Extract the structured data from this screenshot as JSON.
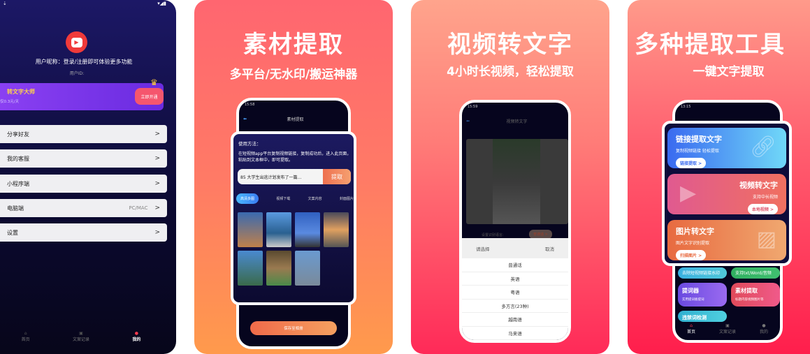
{
  "panel1": {
    "nickname": "用户昵称：登录/注册即可体验更多功能",
    "user_id_label": "用户ID:",
    "vip": {
      "title": "转文字大师",
      "price": "仅0.3元/天",
      "button": "立即开通"
    },
    "menu": [
      {
        "label": "分享好友",
        "right": ""
      },
      {
        "label": "我的客服",
        "right": ""
      },
      {
        "label": "小程序端",
        "right": ""
      },
      {
        "label": "电脑端",
        "right": "PC/MAC"
      },
      {
        "label": "设置",
        "right": ""
      }
    ],
    "nav": [
      "首页",
      "文案记录",
      "我的"
    ],
    "chevron": ">"
  },
  "panel2": {
    "title": "素材提取",
    "subtitle": "多平台/无水印/搬运神器",
    "time": "15:58",
    "screen_title": "素材提取",
    "howto_title": "使用方法：",
    "howto_text": "在短视频app平台复制视频链接，复制成功后，进入此页面，粘贴到文本框中，即可提取。",
    "link_value": "85 大学生出逃计划发布了一篇...",
    "extract_button": "提取",
    "tabs": [
      "高清多图",
      "视频下载",
      "文案内容",
      "封面图片"
    ],
    "save_button": "保存至相册"
  },
  "panel3": {
    "title": "视频转文字",
    "subtitle": "4小时长视频，轻松提取",
    "time": "15:59",
    "screen_title": "视频转文字",
    "lang_label": "设置识别语言:",
    "lang_value": "普通话 >",
    "sheet_title": "请选择",
    "sheet_cancel": "取消",
    "options": [
      "普通话",
      "英语",
      "粤语",
      "多方言(23种)",
      "越南语",
      "马来语"
    ]
  },
  "panel4": {
    "title": "多种提取工具",
    "subtitle": "一键文字提取",
    "time": "13:15",
    "cards": [
      {
        "title": "链接提取文字",
        "desc": "复制视频链接 轻松提取",
        "button": "链接提取 >"
      },
      {
        "title": "视频转文字",
        "desc": "支持中长视频",
        "button": "本地视频 >"
      },
      {
        "title": "图片转文字",
        "desc": "图片文字识别提取",
        "button": "扫描图片 >"
      }
    ],
    "small_cards": [
      {
        "title": "",
        "desc": "去除短视频链接水印"
      },
      {
        "title": "",
        "desc": "支持txt/Word/音频"
      },
      {
        "title": "提词器",
        "desc": "实用提词板提词"
      },
      {
        "title": "素材提取",
        "desc": "标题内容视频图片等"
      },
      {
        "title": "违禁词检测",
        "desc": ""
      }
    ],
    "nav": [
      "首页",
      "文案记录",
      "我的"
    ]
  },
  "colors": {
    "accent_red": "#ff3b4e",
    "vip_purple": "#7b3df0",
    "orange": "#ff8a4c"
  }
}
